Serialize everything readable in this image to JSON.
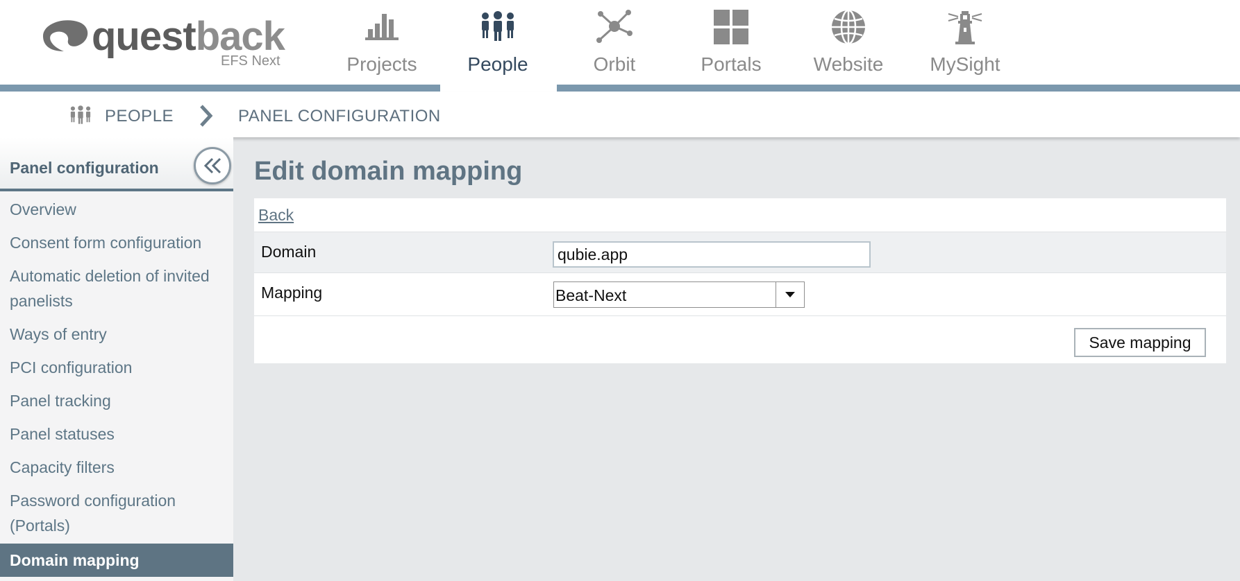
{
  "brand": {
    "logo_text_dark": "quest",
    "logo_text_light": "back",
    "product": "EFS Next",
    "accent": "#7b98ad"
  },
  "nav": {
    "items": [
      {
        "label": "Projects",
        "icon": "bar-chart-icon",
        "active": false
      },
      {
        "label": "People",
        "icon": "people-icon",
        "active": true
      },
      {
        "label": "Orbit",
        "icon": "network-icon",
        "active": false
      },
      {
        "label": "Portals",
        "icon": "grid-icon",
        "active": false
      },
      {
        "label": "Website",
        "icon": "globe-icon",
        "active": false
      },
      {
        "label": "MySight",
        "icon": "lighthouse-icon",
        "active": false
      }
    ]
  },
  "breadcrumb": {
    "icon": "people-icon",
    "items": [
      "PEOPLE",
      "PANEL CONFIGURATION"
    ],
    "separator_icon": "chevron-right-icon"
  },
  "sidebar": {
    "title": "Panel configuration",
    "collapse_icon": "double-chevron-left-icon",
    "items": [
      {
        "label": "Overview",
        "active": false
      },
      {
        "label": "Consent form configuration",
        "active": false
      },
      {
        "label": "Automatic deletion of invited panelists",
        "active": false
      },
      {
        "label": "Ways of entry",
        "active": false
      },
      {
        "label": "PCI configuration",
        "active": false
      },
      {
        "label": "Panel tracking",
        "active": false
      },
      {
        "label": "Panel statuses",
        "active": false
      },
      {
        "label": "Capacity filters",
        "active": false
      },
      {
        "label": "Password configuration (Portals)",
        "active": false
      },
      {
        "label": "Domain mapping",
        "active": true
      }
    ]
  },
  "main": {
    "title": "Edit domain mapping",
    "back_label": "Back",
    "form": {
      "domain_label": "Domain",
      "domain_value": "qubie.app",
      "mapping_label": "Mapping",
      "mapping_value": "Beat-Next",
      "save_label": "Save mapping"
    }
  }
}
